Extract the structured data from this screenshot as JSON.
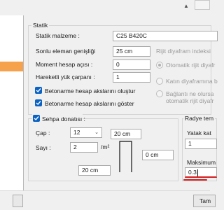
{
  "statik": {
    "group_title": "Statik",
    "material_label": "Statik malzeme :",
    "material_value": "C25 B420C",
    "mesh_width_label": "Sonlu eleman genişliği",
    "mesh_width_value": "25 cm",
    "moment_angle_label": "Moment hesap açısı :",
    "moment_angle_value": "0",
    "live_load_label": "Hareketli yük çarpanı :",
    "live_load_value": "1",
    "rigid_diaphragm_label": "Rijit diyafram indeksi",
    "check_create_axes": "Betonarme hesap akslarını oluştur",
    "check_show_axes": "Betonarme hesap akslarını göster",
    "radio_auto": "Otomatik rijit diyafr",
    "radio_rigid_slab": "Katın diyaframına b",
    "radio_unconnected_1": "Bağlantı ne olursa",
    "radio_unconnected_2": "otomatik rijit diyafr"
  },
  "sehpa": {
    "check_label": "Sehpa donatısı :",
    "cap_label": "Çap :",
    "cap_value": "12",
    "count_label": "Sayı :",
    "count_value": "2",
    "count_unit": "/m²",
    "top_length": "20 cm",
    "right_length": "0 cm",
    "bottom_length": "20 cm"
  },
  "radye": {
    "group_title": "Radye tem",
    "yatak_label": "Yatak kat",
    "yatak_value": "1",
    "max_label": "Maksimum",
    "max_value": "0.3"
  },
  "footer": {
    "cancel_button": "Tam"
  }
}
